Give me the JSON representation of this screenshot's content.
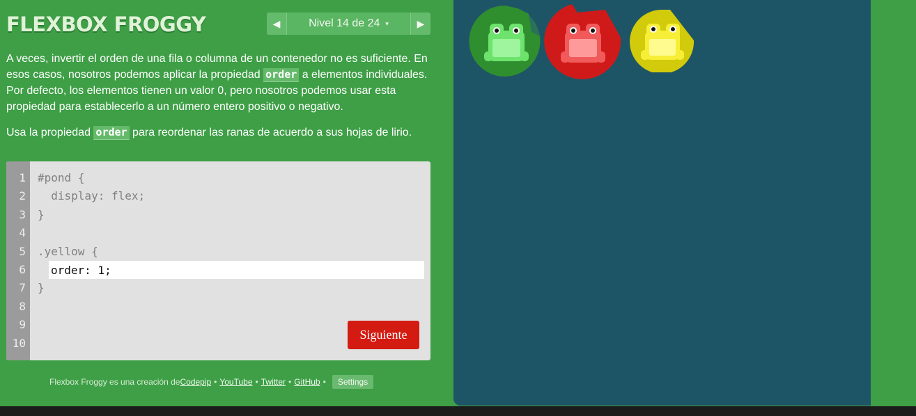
{
  "header": {
    "logo": "FLEXBOX FROGGY",
    "level_label": "Nivel 14 de 24",
    "prev_icon": "◀",
    "next_icon": "▶",
    "caret_icon": "▾"
  },
  "instructions": {
    "p1_a": "A veces, invertir el orden de una fila o columna de un contenedor no es suficiente. En esos casos, nosotros podemos aplicar la propiedad ",
    "p1_code": "order",
    "p1_b": " a elementos individuales. Por defecto, los elementos tienen un valor 0, pero nosotros podemos usar esta propiedad para establecerlo a un número entero positivo o negativo.",
    "p2_a": "Usa la propiedad ",
    "p2_code": "order",
    "p2_b": " para reordenar las ranas de acuerdo a sus hojas de lirio."
  },
  "editor": {
    "line_numbers": [
      "1",
      "2",
      "3",
      "4",
      "5",
      "6",
      "7",
      "8",
      "9",
      "10"
    ],
    "line1": "#pond {",
    "line2": "  display: flex;",
    "line3": "}",
    "line5": ".yellow {",
    "input_value": "order: 1;",
    "line7": "}",
    "next_button": "Siguiente"
  },
  "credits": {
    "prefix": "Flexbox Froggy es una creación de ",
    "link_codepip": "Codepip",
    "link_youtube": "YouTube",
    "link_twitter": "Twitter",
    "link_github": "GitHub",
    "separator": "•",
    "settings": "Settings"
  },
  "pond": {
    "items": [
      {
        "name": "green",
        "lily": "#2f8f2f",
        "frog": "#6de36d",
        "frog_light": "#9ef59e"
      },
      {
        "name": "red",
        "lily": "#d01a1a",
        "frog": "#f15a5a",
        "frog_light": "#ff9a9a"
      },
      {
        "name": "yellow",
        "lily": "#d2cb0c",
        "frog": "#f7ee38",
        "frog_light": "#fffb8f"
      }
    ]
  },
  "colors": {
    "background": "#3e9f46",
    "pond": "#1e5566",
    "next_button": "#d31b12"
  }
}
